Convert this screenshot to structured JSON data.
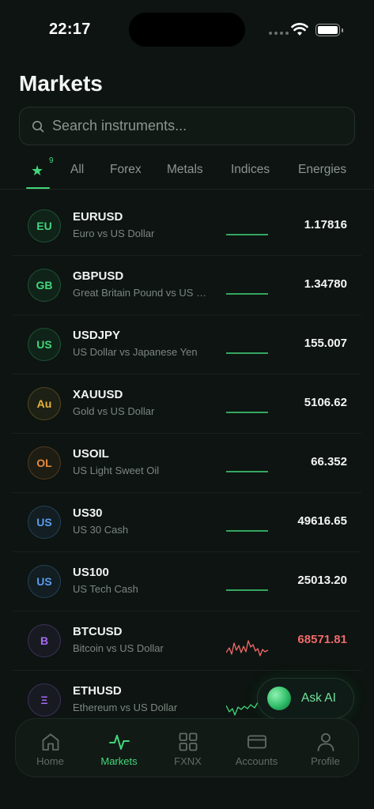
{
  "status": {
    "time": "22:17"
  },
  "header": {
    "title": "Markets"
  },
  "search": {
    "placeholder": "Search instruments..."
  },
  "tabs": {
    "favorites_count": "9",
    "items": [
      "All",
      "Forex",
      "Metals",
      "Indices",
      "Energies"
    ]
  },
  "instruments": [
    {
      "symbol": "EURUSD",
      "name": "Euro vs US Dollar",
      "price": "1.17816",
      "badge": "EU",
      "badge_color": "#41d77a",
      "trend": "flat"
    },
    {
      "symbol": "GBPUSD",
      "name": "Great Britain Pound vs US Dollar",
      "price": "1.34780",
      "badge": "GB",
      "badge_color": "#41d77a",
      "trend": "flat"
    },
    {
      "symbol": "USDJPY",
      "name": "US Dollar vs Japanese Yen",
      "price": "155.007",
      "badge": "US",
      "badge_color": "#41d77a",
      "trend": "flat"
    },
    {
      "symbol": "XAUUSD",
      "name": "Gold vs US Dollar",
      "price": "5106.62",
      "badge": "Au",
      "badge_color": "#e6b43c",
      "trend": "flat"
    },
    {
      "symbol": "USOIL",
      "name": "US Light Sweet Oil",
      "price": "66.352",
      "badge": "OL",
      "badge_color": "#e88a3c",
      "trend": "flat"
    },
    {
      "symbol": "US30",
      "name": "US 30 Cash",
      "price": "49616.65",
      "badge": "US",
      "badge_color": "#5b9cf0",
      "trend": "flat"
    },
    {
      "symbol": "US100",
      "name": "US Tech Cash",
      "price": "25013.20",
      "badge": "US",
      "badge_color": "#5b9cf0",
      "trend": "flat"
    },
    {
      "symbol": "BTCUSD",
      "name": "Bitcoin vs US Dollar",
      "price": "68571.81",
      "badge": "B",
      "badge_color": "#a56cf0",
      "trend": "volatile-down",
      "price_color": "#ef6a6a"
    },
    {
      "symbol": "ETHUSD",
      "name": "Ethereum vs US Dollar",
      "price": "",
      "badge": "Ξ",
      "badge_color": "#a56cf0",
      "trend": "volatile-up"
    }
  ],
  "ask_ai": {
    "label": "Ask AI"
  },
  "nav": {
    "items": [
      {
        "label": "Home",
        "icon": "home-icon"
      },
      {
        "label": "Markets",
        "icon": "pulse-icon",
        "active": true
      },
      {
        "label": "FXNX",
        "icon": "grid-icon"
      },
      {
        "label": "Accounts",
        "icon": "card-icon"
      },
      {
        "label": "Profile",
        "icon": "person-icon"
      }
    ]
  },
  "colors": {
    "accent": "#41d77a",
    "negative": "#ef6a6a",
    "background": "#0d1411"
  }
}
